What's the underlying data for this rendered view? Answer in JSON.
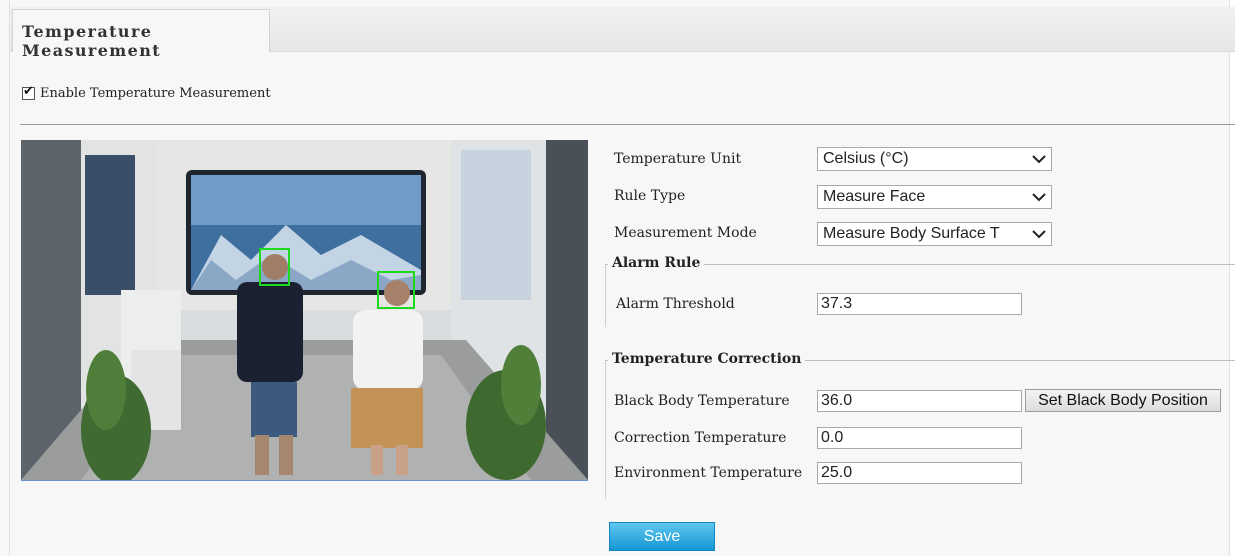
{
  "tabs": [
    {
      "label": "Temperature Measurement",
      "active": true
    }
  ],
  "enable": {
    "label": "Enable Temperature Measurement",
    "checked": true
  },
  "settings": {
    "temperature_unit": {
      "label": "Temperature Unit",
      "value": "Celsius (°C)"
    },
    "rule_type": {
      "label": "Rule Type",
      "value": "Measure Face"
    },
    "measurement_mode": {
      "label": "Measurement Mode",
      "value": "Measure Body Surface T"
    }
  },
  "alarm_rule": {
    "legend": "Alarm Rule",
    "threshold": {
      "label": "Alarm Threshold",
      "value": "37.3"
    }
  },
  "temperature_correction": {
    "legend": "Temperature Correction",
    "black_body": {
      "label": "Black Body Temperature",
      "value": "36.0",
      "button": "Set Black Body Position"
    },
    "correction": {
      "label": "Correction Temperature",
      "value": "0.0"
    },
    "environment": {
      "label": "Environment Temperature",
      "value": "25.0"
    }
  },
  "actions": {
    "save": "Save"
  },
  "icons": {
    "checkbox": "check-icon",
    "dropdown": "chevron-down-icon"
  },
  "colors": {
    "save_button": "#1a9bd7",
    "face_box": "#1ed81e",
    "accent_line": "#6b8fd0"
  }
}
